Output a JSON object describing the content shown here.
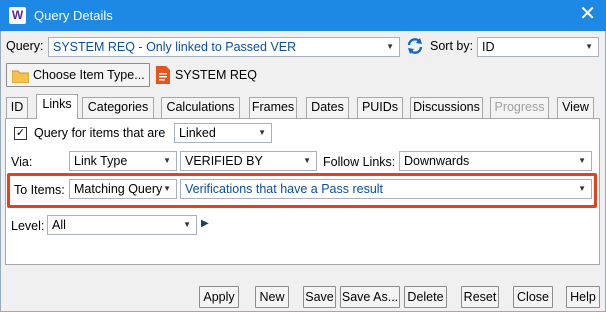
{
  "window": {
    "app_icon_letter": "W",
    "title": "Query Details",
    "close_glyph": "✕"
  },
  "query_row": {
    "label": "Query:",
    "value": "SYSTEM REQ - Only linked to Passed VER",
    "sort_label": "Sort by:",
    "sort_value": "ID"
  },
  "item_type": {
    "button_label": "Choose Item Type...",
    "value": "SYSTEM REQ"
  },
  "tabs": [
    {
      "label": "ID"
    },
    {
      "label": "Links"
    },
    {
      "label": "Categories"
    },
    {
      "label": "Calculations"
    },
    {
      "label": "Frames"
    },
    {
      "label": "Dates"
    },
    {
      "label": "PUIDs"
    },
    {
      "label": "Discussions"
    },
    {
      "label": "Progress"
    },
    {
      "label": "View"
    }
  ],
  "links_tab": {
    "query_checkbox_label": "Query for items that are",
    "query_checked": true,
    "link_state": "Linked",
    "via_label": "Via:",
    "via_type": "Link Type",
    "via_value": "VERIFIED BY",
    "follow_label": "Follow Links:",
    "follow_value": "Downwards",
    "to_items_label": "To Items:",
    "to_items_mode": "Matching Query",
    "to_items_query": "Verifications that have a Pass result",
    "level_label": "Level:",
    "level_value": "All"
  },
  "buttons": {
    "apply": "Apply",
    "new": "New",
    "save": "Save",
    "save_as": "Save As...",
    "delete": "Delete",
    "reset": "Reset",
    "close": "Close",
    "help": "Help"
  },
  "colors": {
    "titlebar": "#1e88e5",
    "highlight": "#e8401c",
    "link_text": "#0b4fa0"
  }
}
